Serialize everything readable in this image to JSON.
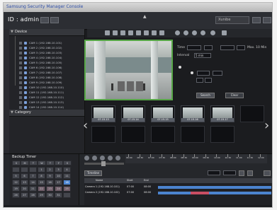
{
  "window": {
    "title": "Samsung Security Manager Console",
    "user": "ID : admin"
  },
  "header": {
    "layout_select": "Xunibe",
    "view_select": "",
    "caret": "▲"
  },
  "panels": {
    "device": "Device",
    "category": "Category"
  },
  "cameras": [
    "CAM 1 (192.168.10.101)",
    "CAM 2 (192.168.10.102)",
    "CAM 3 (192.168.10.103)",
    "CAM 4 (192.168.10.104)",
    "CAM 5 (192.168.10.105)",
    "CAM 6 (192.168.10.106)",
    "CAM 7 (192.168.10.107)",
    "CAM 8 (192.168.10.108)",
    "CAM 9 (192.168.10.109)",
    "CAM 10 (192.168.10.110)",
    "CAM 11 (192.168.10.111)",
    "CAM 12 (192.168.10.112)",
    "CAM 13 (192.168.10.113)",
    "CAM 14 (192.168.10.114)",
    "CAM 15 (192.168.10.115)"
  ],
  "form": {
    "time_label": "Time",
    "interval_label": "Interval",
    "interval_value": "5 min",
    "option1": "Max. 10 Min",
    "option2": "",
    "search_button": "Search",
    "clear_button": "Clear"
  },
  "thumbnails": [
    "07.15.13",
    "07.15.14",
    "07.15.15",
    "07.15.16",
    "07.15.17"
  ],
  "bottom": {
    "backup_title": "Backup Timer",
    "calendar": {
      "weekdays": [
        "S",
        "M",
        "T",
        "W",
        "T",
        "F",
        "S"
      ],
      "days": [
        "",
        "",
        "",
        "1",
        "2",
        "3",
        "4",
        "5",
        "6",
        "7",
        "8",
        "9",
        "10",
        "11",
        "12",
        "13",
        "14",
        "15",
        "16",
        "17",
        "18",
        "19",
        "20",
        "21",
        "22",
        "23",
        "24",
        "25",
        "26",
        "27",
        "28",
        "29",
        "30",
        "31",
        ""
      ],
      "active_day": "18"
    },
    "timeline_button": "Timeline",
    "timeline_headers": [
      "Name",
      "Start",
      "End"
    ],
    "rows": [
      {
        "name": "Camera 1 (192.168.10.101)",
        "start": "07:00",
        "end": "08:00"
      },
      {
        "name": "Camera 2 (192.168.10.102)",
        "start": "07:00",
        "end": "08:00"
      }
    ],
    "ticks": [
      "06:00",
      "06:30",
      "07:00",
      "07:30",
      "08:00",
      "08:30",
      "09:00",
      "09:30",
      "10:00",
      "10:30",
      "11:00",
      "11:30",
      "12:00"
    ]
  },
  "colors": {
    "accent_green": "#58a748",
    "accent_blue": "#4c84cf",
    "highlight_red": "#c94e63"
  }
}
